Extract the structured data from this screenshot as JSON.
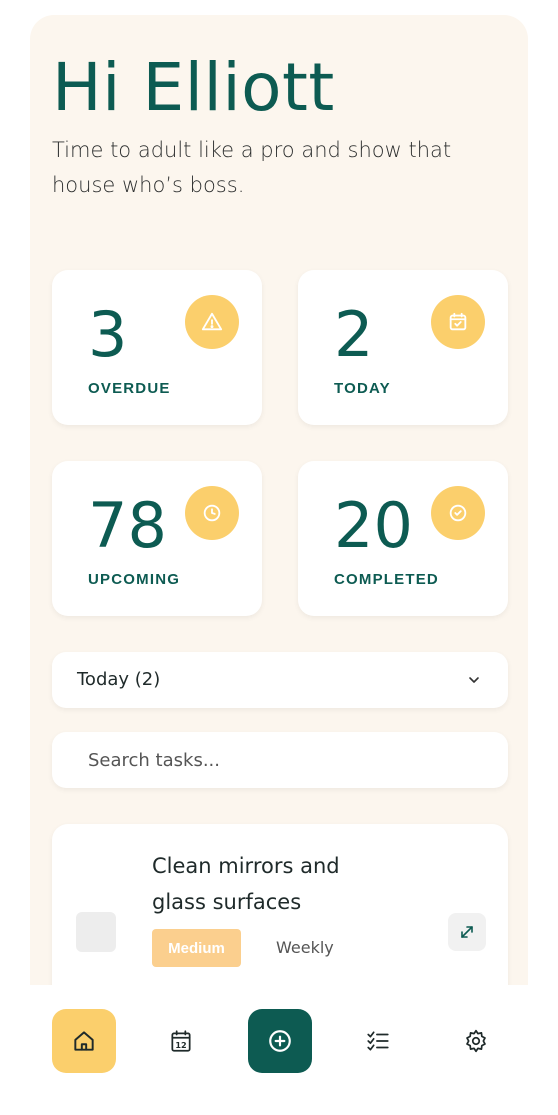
{
  "header": {
    "greeting": "Hi Elliott",
    "subtitle": "Time to adult like a pro and show that house who’s boss."
  },
  "stats": [
    {
      "value": "3",
      "label": "OVERDUE",
      "icon": "warning-icon"
    },
    {
      "value": "2",
      "label": "TODAY",
      "icon": "calendar-check-icon"
    },
    {
      "value": "78",
      "label": "UPCOMING",
      "icon": "clock-icon"
    },
    {
      "value": "20",
      "label": "COMPLETED",
      "icon": "check-circle-icon"
    }
  ],
  "filter": {
    "selected": "Today (2)"
  },
  "search": {
    "placeholder": "Search tasks..."
  },
  "task": {
    "title": "Clean mirrors and glass surfaces",
    "priority": "Medium",
    "frequency": "Weekly"
  },
  "nav": {
    "items": [
      {
        "icon": "home-icon",
        "active": true
      },
      {
        "icon": "calendar-icon",
        "text": "12"
      },
      {
        "icon": "add-icon"
      },
      {
        "icon": "checklist-icon"
      },
      {
        "icon": "settings-icon"
      }
    ]
  },
  "colors": {
    "primary": "#0d5b52",
    "accent": "#fbcf6c",
    "background": "#fcf6ee",
    "priority_medium": "#fbcf8e"
  }
}
